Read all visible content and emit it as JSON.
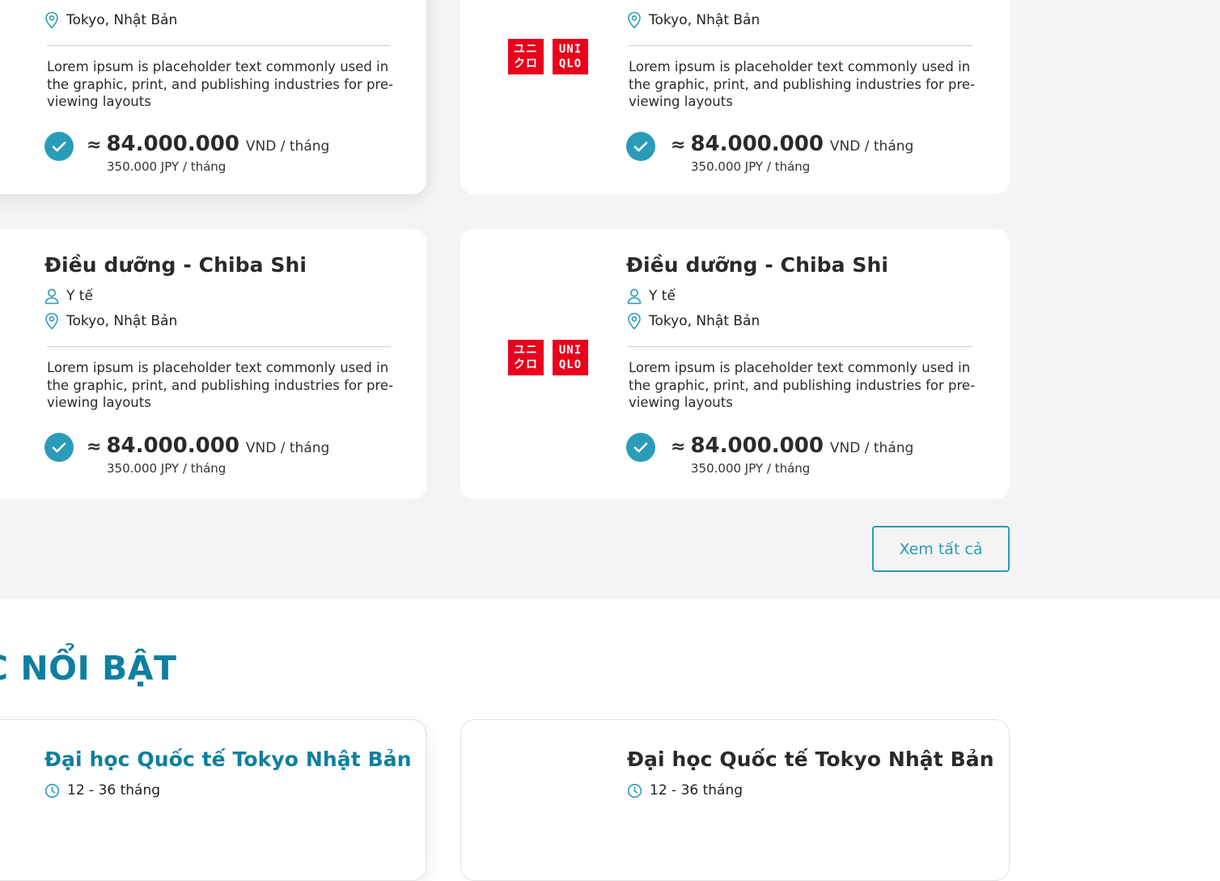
{
  "jobs": [
    {
      "location": "Tokyo, Nhật Bản",
      "description": "Lorem ipsum is placeholder text commonly used in the graphic, print, and publishing industries for pre-viewing layouts",
      "price_approx": "≈",
      "price_vnd": "84.000.000",
      "price_vnd_unit": "VND / tháng",
      "price_jpy": "350.000 JPY / tháng"
    },
    {
      "location": "Tokyo, Nhật Bản",
      "description": "Lorem ipsum is placeholder text commonly used in the graphic, print, and publishing industries for pre-viewing layouts",
      "price_approx": "≈",
      "price_vnd": "84.000.000",
      "price_vnd_unit": "VND / tháng",
      "price_jpy": "350.000 JPY / tháng",
      "logo": [
        "ユニ",
        "クロ",
        "UNI",
        "QLO"
      ]
    },
    {
      "title": "Điều dưỡng - Chiba Shi",
      "category": "Y tế",
      "location": "Tokyo, Nhật Bản",
      "description": "Lorem ipsum is placeholder text commonly used in the graphic, print, and publishing industries for pre-viewing layouts",
      "price_approx": "≈",
      "price_vnd": "84.000.000",
      "price_vnd_unit": "VND / tháng",
      "price_jpy": "350.000 JPY / tháng"
    },
    {
      "title": "Điều dưỡng - Chiba Shi",
      "category": "Y tế",
      "location": "Tokyo, Nhật Bản",
      "description": "Lorem ipsum is placeholder text commonly used in the graphic, print, and publishing industries for pre-viewing layouts",
      "price_approx": "≈",
      "price_vnd": "84.000.000",
      "price_vnd_unit": "VND / tháng",
      "price_jpy": "350.000 JPY / tháng",
      "logo": [
        "ユニ",
        "クロ",
        "UNI",
        "QLO"
      ]
    }
  ],
  "view_all_label": "Xem tất cả",
  "featured_section_title": "C NỔI BẬT",
  "schools": [
    {
      "title": "Đại học Quốc tế Tokyo Nhật Bản",
      "duration": "12 - 36 tháng"
    },
    {
      "title": "Đại học Quốc tế Tokyo Nhật Bản",
      "duration": "12 - 36 tháng"
    }
  ],
  "colors": {
    "accent": "#2a9cb8",
    "heading_teal": "#0e7fa0",
    "brand_red": "#e8001d",
    "band_gray": "#f4f4f4"
  },
  "icons": [
    "user-icon",
    "location-pin-icon",
    "check-circle-icon",
    "clock-icon"
  ]
}
